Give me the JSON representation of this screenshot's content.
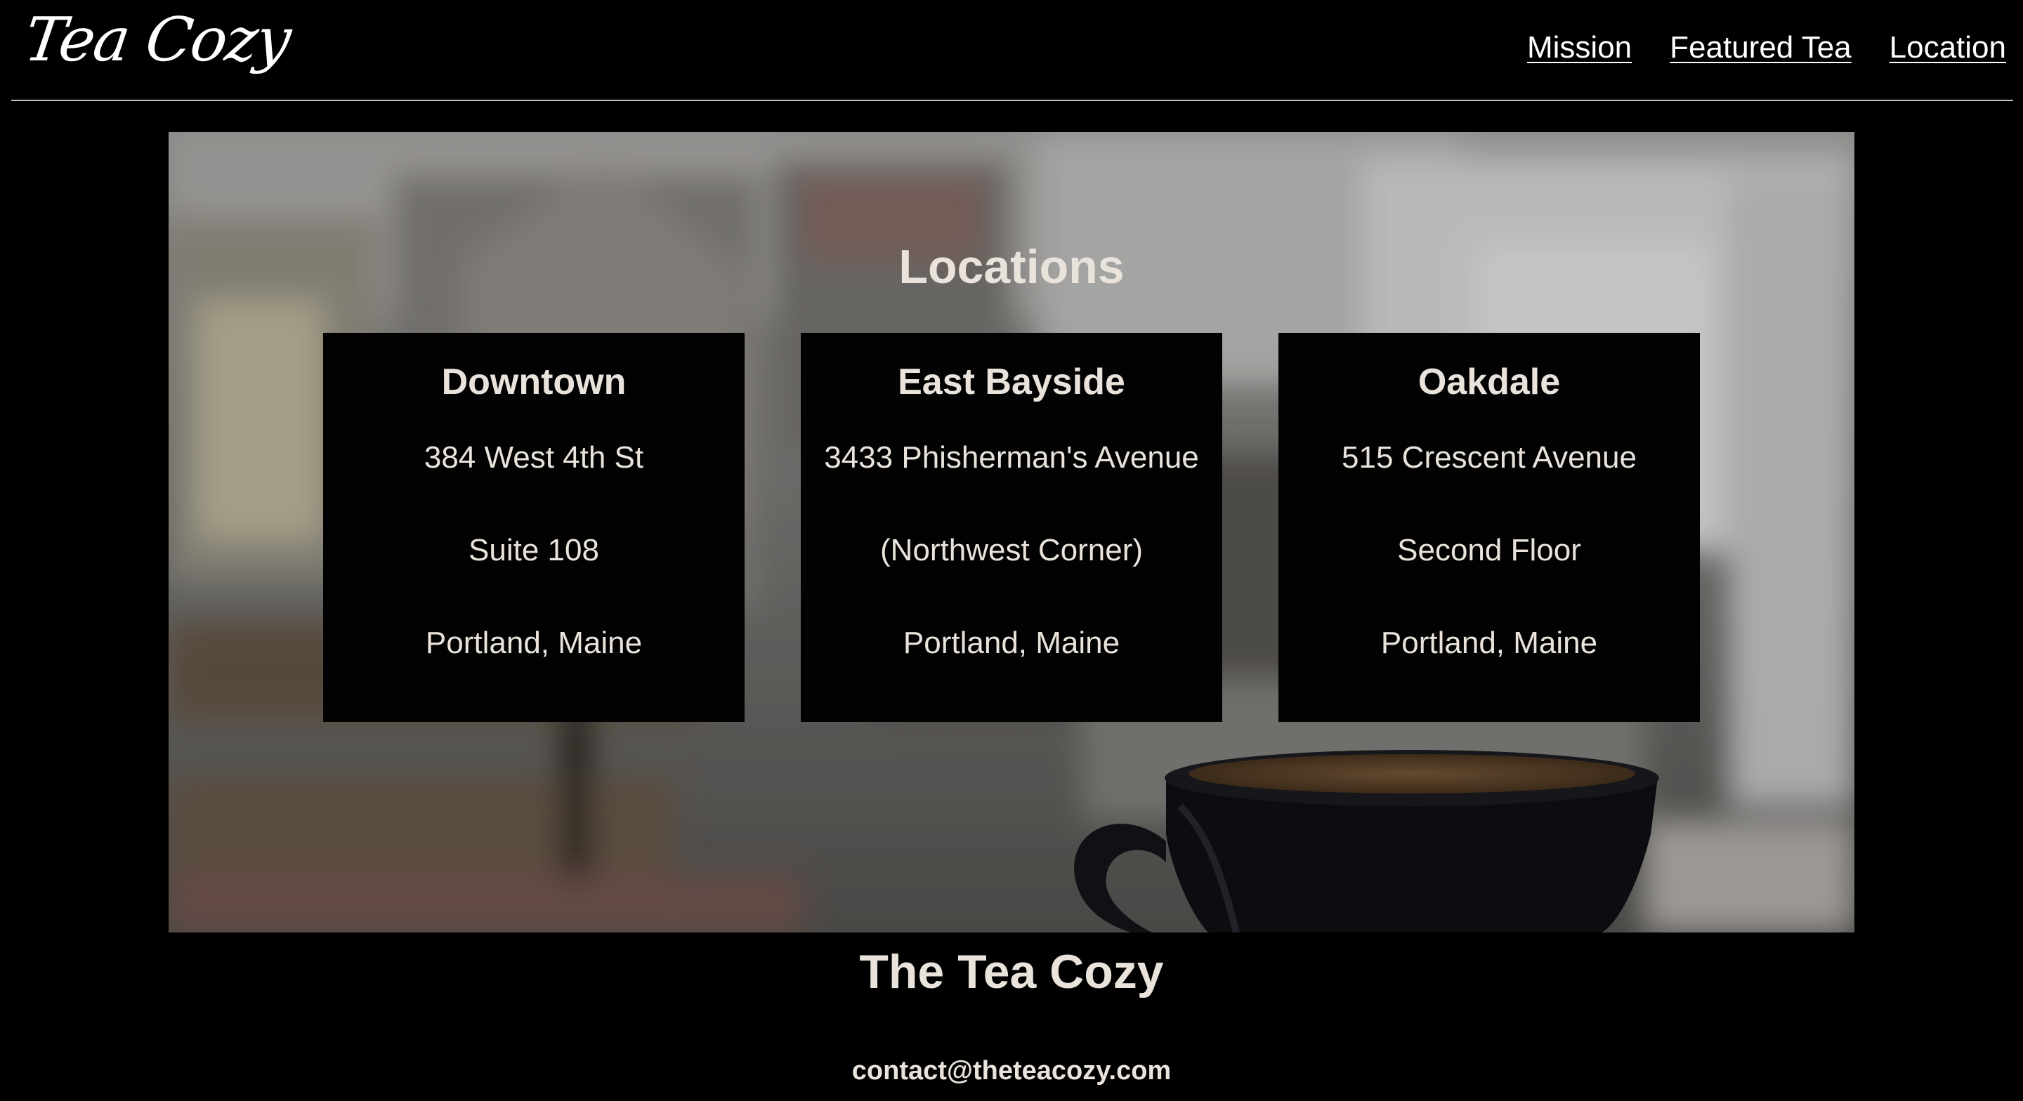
{
  "header": {
    "logo_text": "Tea Cozy",
    "nav": [
      {
        "label": "Mission"
      },
      {
        "label": "Featured Tea"
      },
      {
        "label": "Location"
      }
    ]
  },
  "hero": {
    "title": "Locations",
    "locations": [
      {
        "name": "Downtown",
        "line1": "384 West 4th St",
        "line2": "Suite 108",
        "line3": "Portland, Maine"
      },
      {
        "name": "East Bayside",
        "line1": "3433 Phisherman's Avenue",
        "line2": "(Northwest Corner)",
        "line3": "Portland, Maine"
      },
      {
        "name": "Oakdale",
        "line1": "515 Crescent Avenue",
        "line2": "Second Floor",
        "line3": "Portland, Maine"
      }
    ]
  },
  "footer": {
    "title": "The Tea Cozy",
    "email": "contact@theteacozy.com"
  }
}
